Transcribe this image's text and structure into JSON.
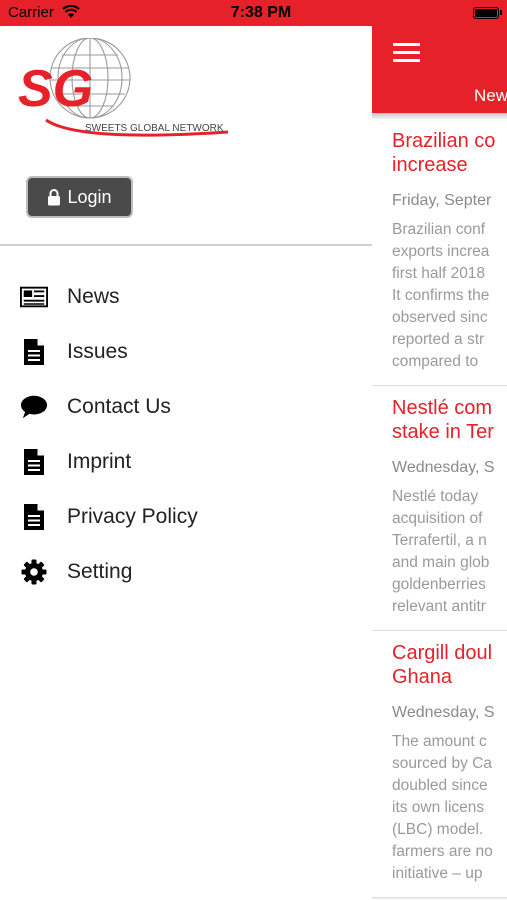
{
  "status_bar": {
    "carrier": "Carrier",
    "time": "7:38 PM"
  },
  "drawer": {
    "logo": {
      "initials": "SG",
      "tagline": "SWEETS GLOBAL NETWORK"
    },
    "login_label": "Login",
    "menu": [
      {
        "label": "News",
        "icon": "newspaper-icon"
      },
      {
        "label": "Issues",
        "icon": "document-icon"
      },
      {
        "label": "Contact Us",
        "icon": "speech-bubble-icon"
      },
      {
        "label": "Imprint",
        "icon": "document-icon"
      },
      {
        "label": "Privacy Policy",
        "icon": "document-icon"
      },
      {
        "label": "Setting",
        "icon": "gear-icon"
      }
    ]
  },
  "main": {
    "nav_title": "New",
    "articles": [
      {
        "title_lines": [
          "Brazilian co",
          "increase"
        ],
        "date": "Friday, Septer",
        "excerpt_lines": [
          "Brazilian conf",
          "exports increa",
          "first half 2018",
          "It confirms the",
          "observed sinc",
          "reported a str",
          "compared to"
        ]
      },
      {
        "title_lines": [
          "Nestlé com",
          "stake in Ter"
        ],
        "date": "Wednesday, S",
        "excerpt_lines": [
          "Nestlé today",
          "acquisition of",
          "Terrafertil, a n",
          "and main glob",
          "goldenberries",
          "relevant antitr"
        ]
      },
      {
        "title_lines": [
          "Cargill doul",
          "Ghana"
        ],
        "date": "Wednesday, S",
        "excerpt_lines": [
          "The amount c",
          "sourced by Ca",
          "doubled since",
          "its own licens",
          "(LBC) model.",
          "farmers are no",
          "initiative – up"
        ]
      }
    ]
  },
  "colors": {
    "brand_red": "#e62129",
    "login_bg": "#4a4a4a"
  }
}
